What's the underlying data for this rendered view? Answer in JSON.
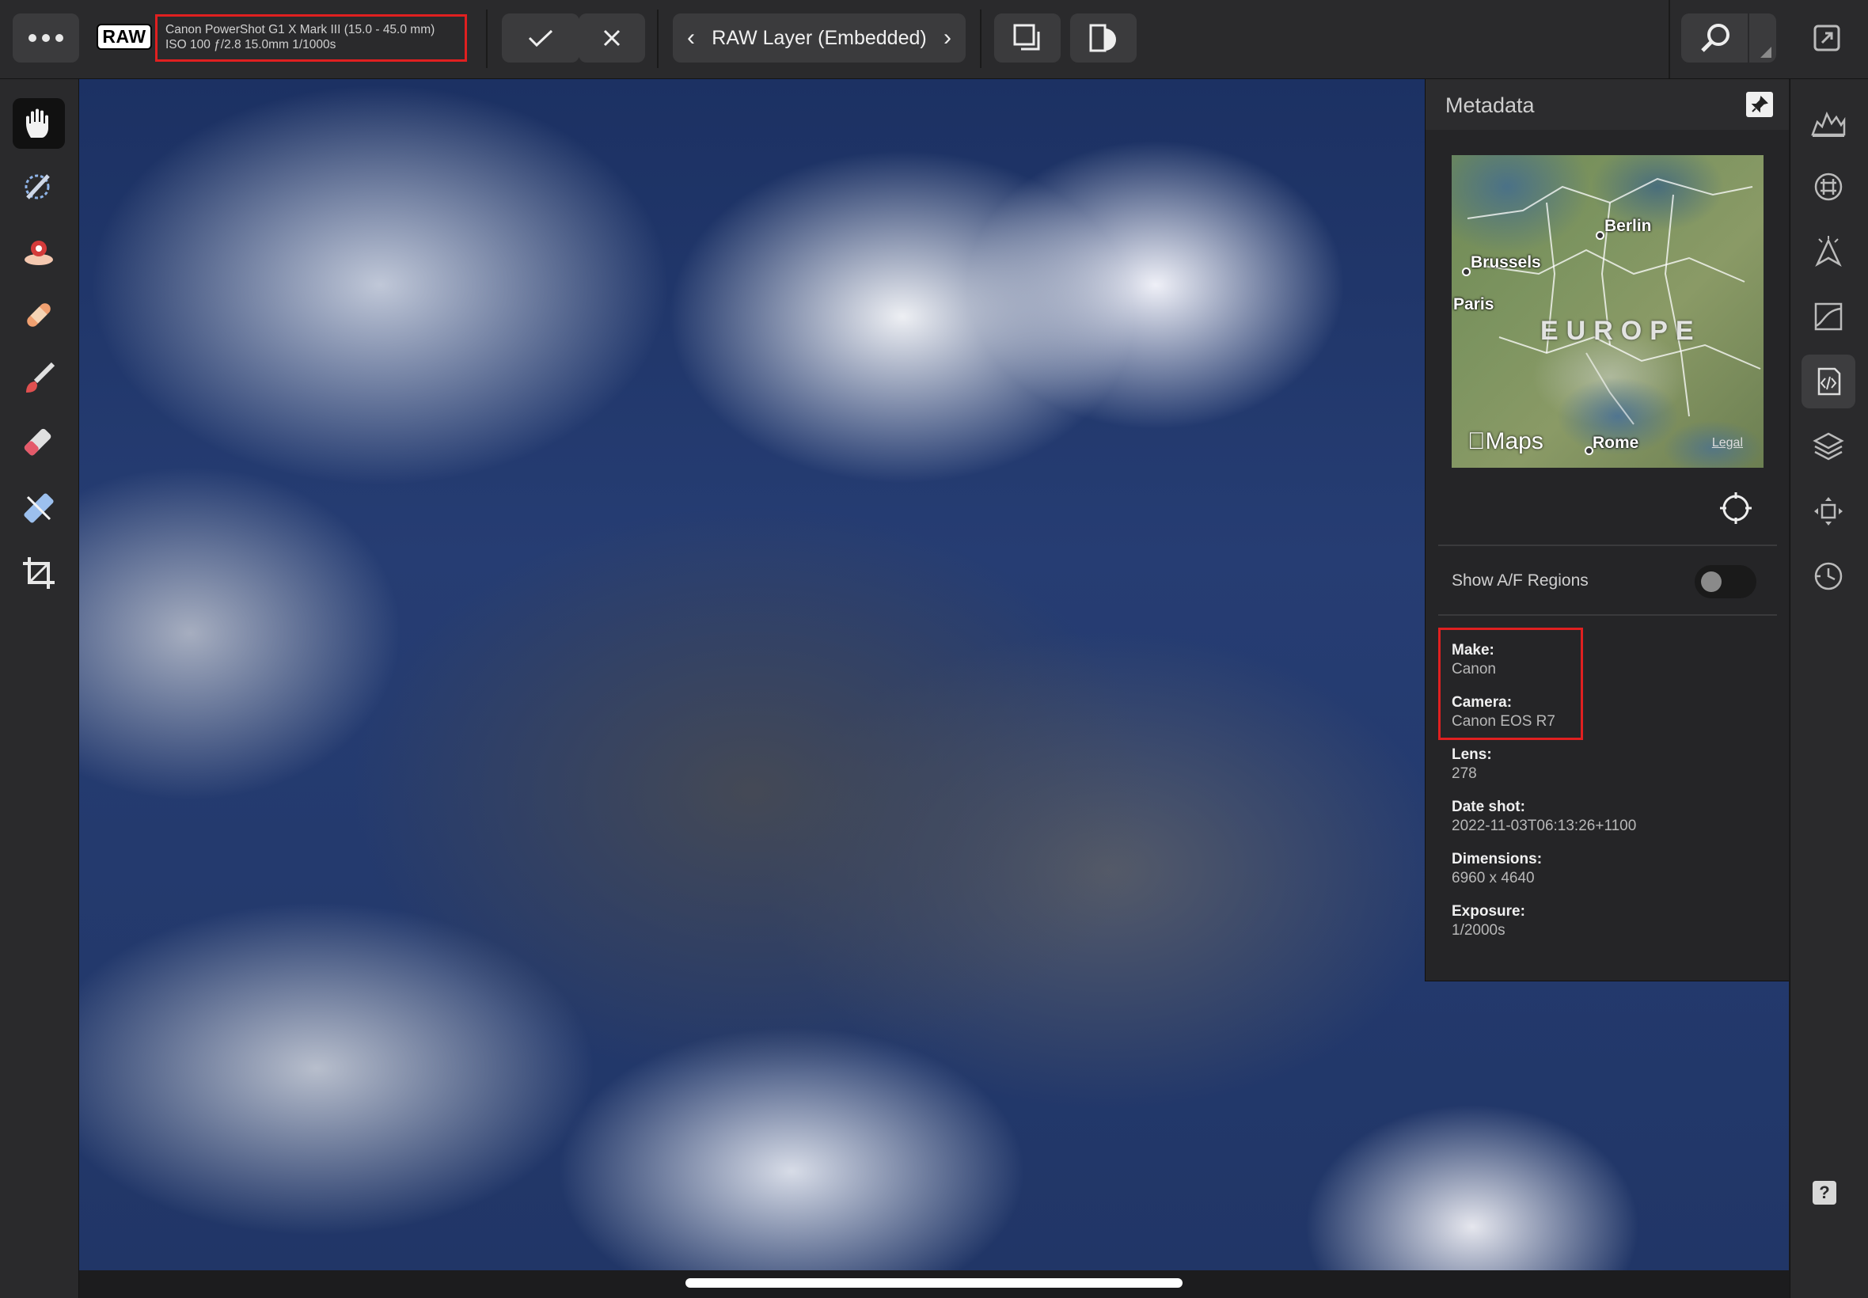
{
  "toolbar": {
    "raw_badge": "RAW",
    "camera_line1": "Canon PowerShot G1 X Mark III (15.0 - 45.0 mm)",
    "camera_line2": "ISO 100 ƒ/2.8 15.0mm 1/1000s",
    "layer_label": "RAW Layer (Embedded)"
  },
  "metadata": {
    "title": "Metadata",
    "map": {
      "cities": [
        "Berlin",
        "Brussels",
        "Paris",
        "Rome"
      ],
      "region": "EUROPE",
      "brand": "Maps",
      "legal": "Legal"
    },
    "show_af_label": "Show A/F Regions",
    "show_af_on": false,
    "fields": [
      {
        "key": "Make:",
        "value": "Canon"
      },
      {
        "key": "Camera:",
        "value": "Canon EOS R7"
      },
      {
        "key": "Lens:",
        "value": "278"
      },
      {
        "key": "Date shot:",
        "value": "2022-11-03T06:13:26+1100"
      },
      {
        "key": "Dimensions:",
        "value": "6960 x 4640"
      },
      {
        "key": "Exposure:",
        "value": "1/2000s"
      }
    ]
  },
  "help": "?"
}
